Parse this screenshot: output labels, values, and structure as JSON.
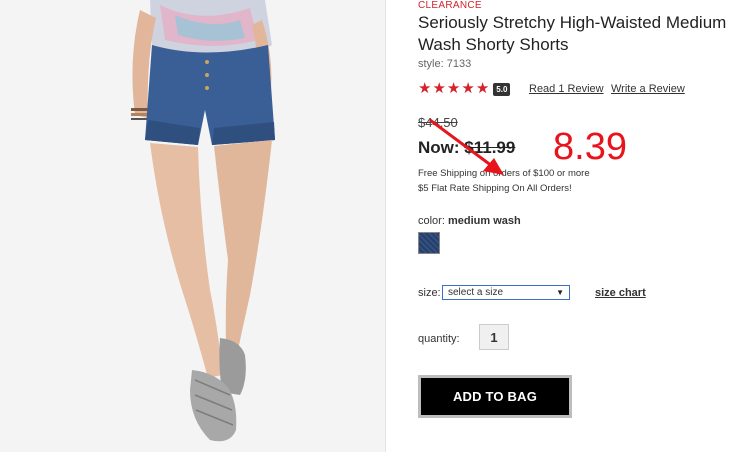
{
  "product": {
    "badge": "CLEARANCE",
    "title": "Seriously Stretchy High-Waisted Medium Wash Shorty Shorts",
    "style": "style: 7133",
    "rating_value": "5.0",
    "stars": 5,
    "read_review_label": "Read 1 Review",
    "write_review_label": "Write a Review",
    "original_price": "$44.50",
    "now_label": "Now:",
    "now_price": "$11.99",
    "annotation_price": "8.39",
    "shipping_line1": "Free Shipping on orders of $100 or more",
    "shipping_line2": "$5 Flat Rate Shipping On All Orders!",
    "color_label": "color:",
    "color_value": "medium wash",
    "size_label": "size:",
    "size_placeholder": "select a size",
    "size_chart_label": "size chart",
    "quantity_label": "quantity:",
    "quantity_value": "1",
    "add_to_bag_label": "ADD TO BAG"
  },
  "colors": {
    "accent_red": "#d3242b",
    "annotation_red": "#e8141b",
    "button_bg": "#000000"
  },
  "icons": {
    "star": "star-icon",
    "dropdown": "chevron-down-icon"
  }
}
